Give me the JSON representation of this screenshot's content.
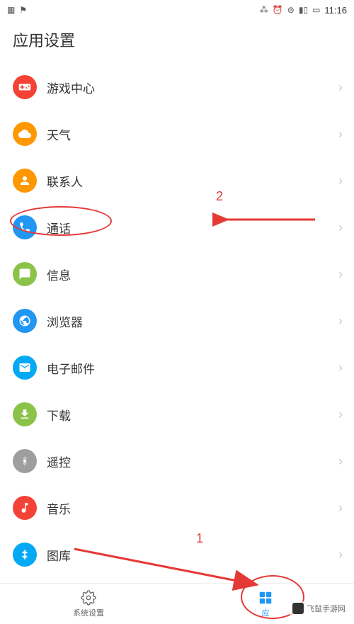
{
  "status_bar": {
    "time": "11:16"
  },
  "header": {
    "title": "应用设置"
  },
  "items": [
    {
      "label": "游戏中心",
      "icon_color": "#f44336",
      "icon_name": "gamepad-icon"
    },
    {
      "label": "天气",
      "icon_color": "#ff9800",
      "icon_name": "weather-icon"
    },
    {
      "label": "联系人",
      "icon_color": "#ff9800",
      "icon_name": "contacts-icon"
    },
    {
      "label": "通话",
      "icon_color": "#2196f3",
      "icon_name": "phone-icon"
    },
    {
      "label": "信息",
      "icon_color": "#8bc34a",
      "icon_name": "message-icon"
    },
    {
      "label": "浏览器",
      "icon_color": "#2196f3",
      "icon_name": "browser-icon"
    },
    {
      "label": "电子邮件",
      "icon_color": "#03a9f4",
      "icon_name": "email-icon"
    },
    {
      "label": "下载",
      "icon_color": "#8bc34a",
      "icon_name": "download-icon"
    },
    {
      "label": "遥控",
      "icon_color": "#9e9e9e",
      "icon_name": "remote-icon"
    },
    {
      "label": "音乐",
      "icon_color": "#f44336",
      "icon_name": "music-icon"
    },
    {
      "label": "图库",
      "icon_color": "#03a9f4",
      "icon_name": "gallery-icon"
    }
  ],
  "bottom_nav": {
    "system": {
      "label": "系统设置"
    },
    "app": {
      "label": "应"
    }
  },
  "annotations": {
    "label_1": "1",
    "label_2": "2"
  },
  "watermark": {
    "text": "飞鼠手游网"
  }
}
